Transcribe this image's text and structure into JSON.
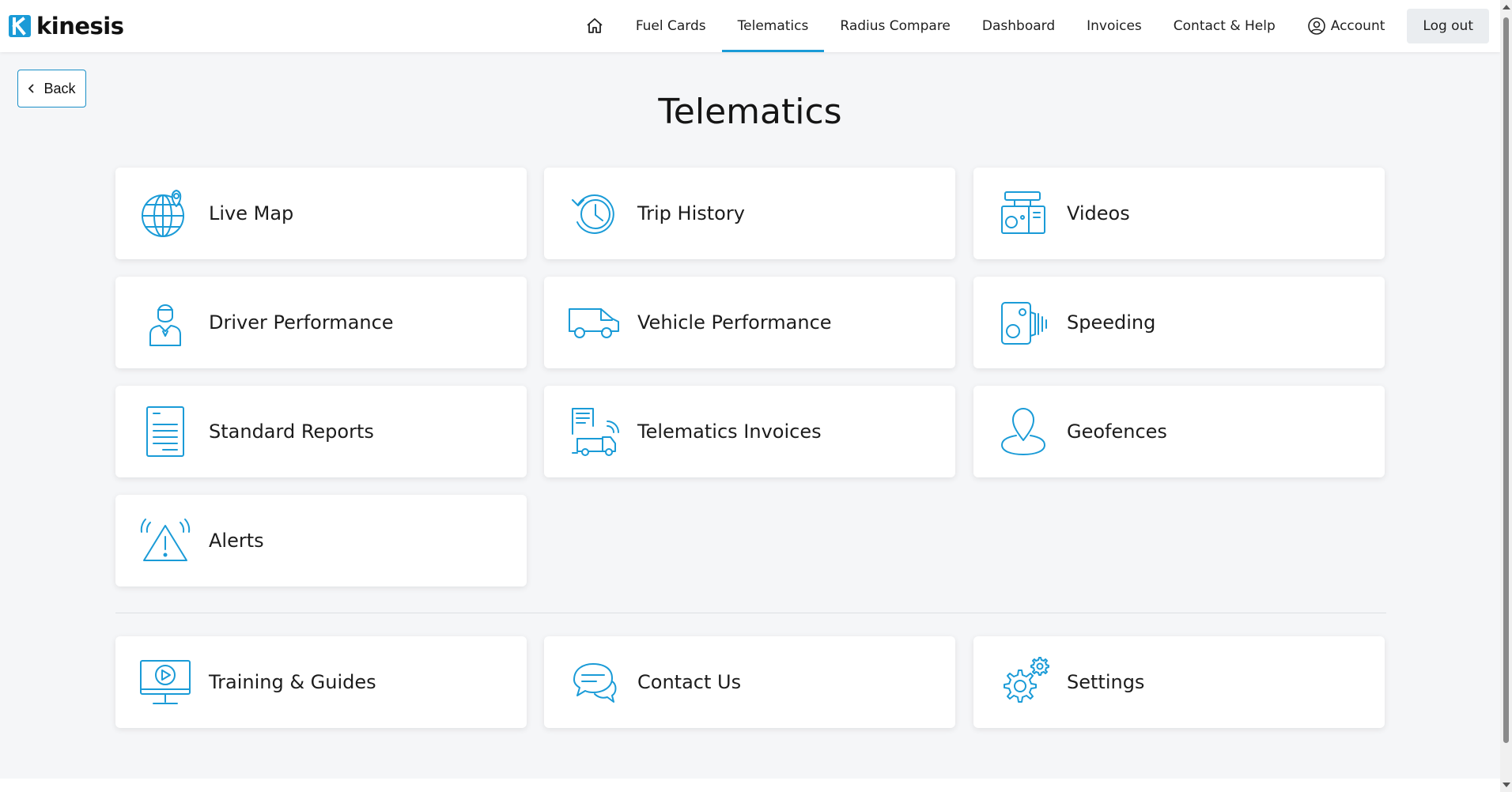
{
  "brand": {
    "name": "kinesis"
  },
  "nav": {
    "items": [
      {
        "label": "Fuel Cards"
      },
      {
        "label": "Telematics",
        "active": true
      },
      {
        "label": "Radius Compare"
      },
      {
        "label": "Dashboard"
      },
      {
        "label": "Invoices"
      },
      {
        "label": "Contact & Help"
      }
    ],
    "account_label": "Account",
    "logout_label": "Log out"
  },
  "back_label": "Back",
  "page_title": "Telematics",
  "tiles": [
    {
      "label": "Live Map",
      "icon": "globe-pin-icon"
    },
    {
      "label": "Trip History",
      "icon": "clock-history-icon"
    },
    {
      "label": "Videos",
      "icon": "dashcam-icon"
    },
    {
      "label": "Driver Performance",
      "icon": "driver-icon"
    },
    {
      "label": "Vehicle Performance",
      "icon": "van-icon"
    },
    {
      "label": "Speeding",
      "icon": "speed-camera-icon"
    },
    {
      "label": "Standard Reports",
      "icon": "document-icon"
    },
    {
      "label": "Telematics Invoices",
      "icon": "invoice-van-icon"
    },
    {
      "label": "Geofences",
      "icon": "location-pin-icon"
    },
    {
      "label": "Alerts",
      "icon": "alert-icon"
    }
  ],
  "support_tiles": [
    {
      "label": "Training & Guides",
      "icon": "video-monitor-icon"
    },
    {
      "label": "Contact Us",
      "icon": "chat-bubbles-icon"
    },
    {
      "label": "Settings",
      "icon": "gears-icon"
    }
  ],
  "colors": {
    "accent": "#1a9bd7",
    "background": "#f5f6f8"
  }
}
